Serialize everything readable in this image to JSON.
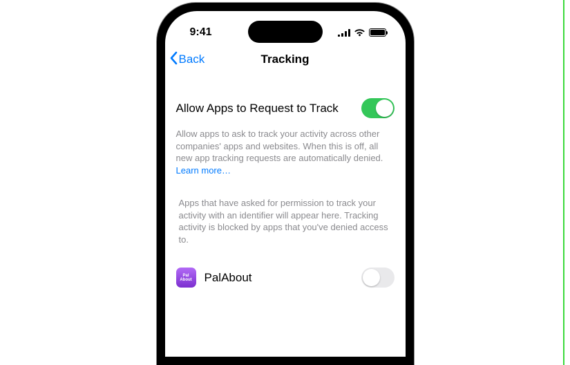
{
  "statusbar": {
    "time": "9:41"
  },
  "nav": {
    "back_label": "Back",
    "title": "Tracking"
  },
  "allow_section": {
    "title": "Allow Apps to Request to Track",
    "toggle_on": true,
    "footer_text": "Allow apps to ask to track your activity across other companies' apps and websites. When this is off, all new app tracking requests are automatically denied. ",
    "learn_more": "Learn more…"
  },
  "apps_section": {
    "note": "Apps that have asked for permission to track your activity with an identifier will appear here. Tracking activity is blocked by apps that you've denied access to.",
    "items": [
      {
        "icon_line1": "Pal",
        "icon_line2": "About",
        "name": "PalAbout",
        "toggle_on": false
      }
    ]
  }
}
